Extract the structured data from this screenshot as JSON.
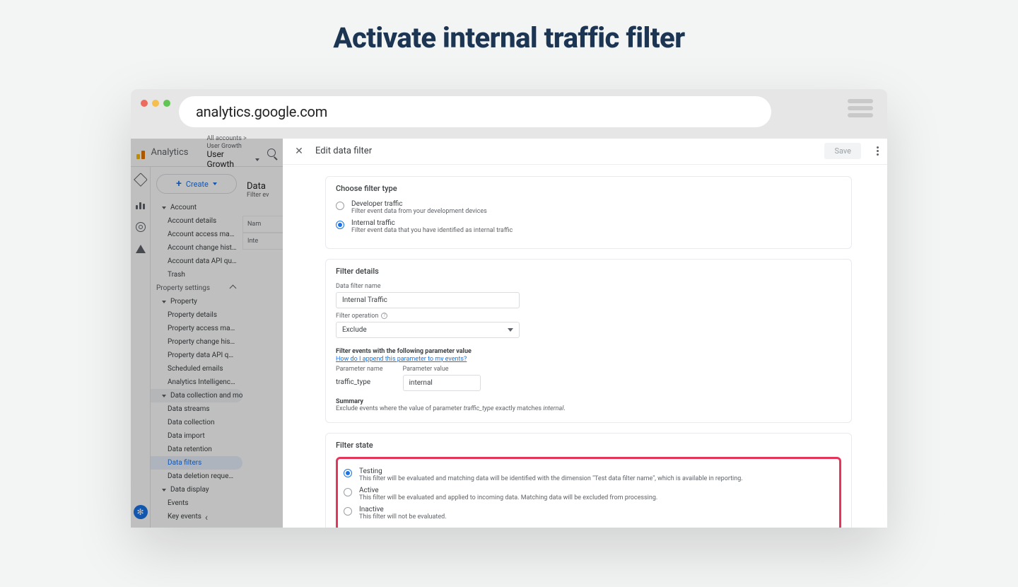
{
  "page": {
    "heading": "Activate internal traffic filter"
  },
  "browser": {
    "url": "analytics.google.com"
  },
  "header": {
    "brand": "Analytics",
    "breadcrumb": "All accounts > User Growth",
    "property": "User Growth"
  },
  "sidebar": {
    "create": "Create",
    "account": {
      "label": "Account",
      "items": [
        "Account details",
        "Account access managem…",
        "Account change history",
        "Account data API quota his…",
        "Trash"
      ]
    },
    "property_settings": "Property settings",
    "property": {
      "label": "Property",
      "items": [
        "Property details",
        "Property access managem…",
        "Property change history",
        "Property data API quota his…",
        "Scheduled emails",
        "Analytics Intelligence sear…"
      ]
    },
    "data_collect": {
      "label": "Data collection and modifica…",
      "items": [
        "Data streams",
        "Data collection",
        "Data import",
        "Data retention",
        "Data filters",
        "Data deletion requests"
      ],
      "selected": "Data filters"
    },
    "data_display": {
      "label": "Data display",
      "items": [
        "Events",
        "Key events"
      ]
    },
    "page_peek": {
      "title": "Data",
      "subtitle": "Filter ev",
      "col_label": "Nam",
      "cell": "Inte"
    }
  },
  "panel": {
    "title": "Edit data filter",
    "save": "Save",
    "filter_type": {
      "heading": "Choose filter type",
      "options": [
        {
          "title": "Developer traffic",
          "desc": "Filter event data from your development devices"
        },
        {
          "title": "Internal traffic",
          "desc": "Filter event data that you have identified as internal traffic"
        }
      ],
      "selected": 1
    },
    "details": {
      "heading": "Filter details",
      "name_label": "Data filter name",
      "name_value": "Internal Traffic",
      "op_label": "Filter operation",
      "op_value": "Exclude",
      "param_heading": "Filter events with the following parameter value",
      "param_link": "How do I append this parameter to my events?",
      "param_name_label": "Parameter name",
      "param_name_value": "traffic_type",
      "param_value_label": "Parameter value",
      "param_value_value": "internal",
      "summary_label": "Summary",
      "summary_pre": "Exclude events where the value of parameter ",
      "summary_p": "traffic_type",
      "summary_mid": " exactly matches ",
      "summary_v": "internal",
      "summary_post": "."
    },
    "state": {
      "heading": "Filter state",
      "options": [
        {
          "title": "Testing",
          "desc": "This filter will be evaluated and matching data will be identified with the dimension \"Test data filter name\", which is available in reporting."
        },
        {
          "title": "Active",
          "desc": "This filter will be evaluated and applied to incoming data. Matching data will be excluded from processing."
        },
        {
          "title": "Inactive",
          "desc": "This filter will not be evaluated."
        }
      ],
      "selected": 0
    }
  }
}
